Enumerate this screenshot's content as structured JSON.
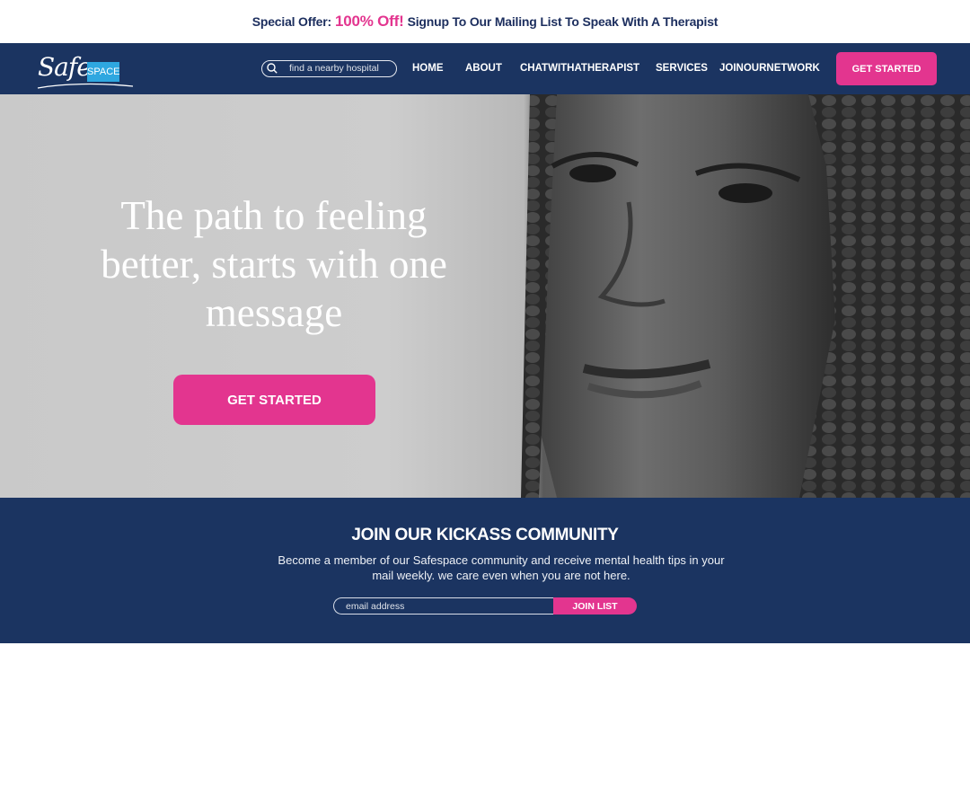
{
  "promo": {
    "prefix": "Special Offer:",
    "highlight": "100% Off!",
    "suffix": "Signup To Our Mailing List To Speak With A Therapist"
  },
  "brand": {
    "logo_script": "Safe",
    "logo_box": "SPACE"
  },
  "nav": {
    "search_placeholder": "find a nearby hospital",
    "links": [
      "HOME",
      "ABOUT",
      "CHATWITHATHERAPIST",
      "SERVICES",
      "JOINOURNETWORK"
    ],
    "cta_label": "GET STARTED"
  },
  "hero": {
    "headline": "The path to feeling better, starts with one message",
    "cta_label": "GET STARTED"
  },
  "community": {
    "heading": "JOIN OUR KICKASS COMMUNITY",
    "body": "Become a member of our Safespace community and receive mental health tips in your mail weekly. we care even when you are not here.",
    "email_placeholder": "email address",
    "join_label": "JOIN LIST"
  },
  "colors": {
    "navy": "#1b3461",
    "pink": "#e3358f",
    "sky": "#2ea7e0"
  }
}
